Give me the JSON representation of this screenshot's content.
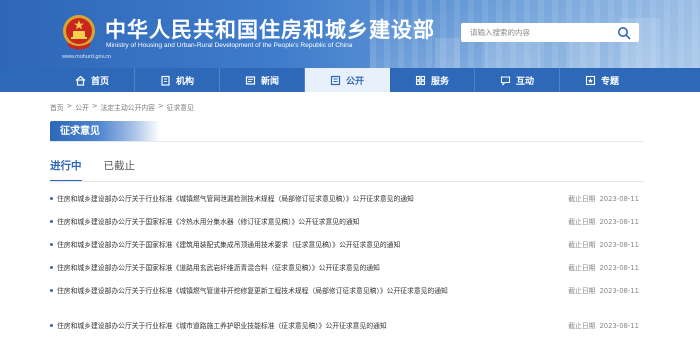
{
  "header": {
    "title": "中华人民共和国住房和城乡建设部",
    "subtitle": "Ministry of Housing and Urban-Rural Development of the People's Republic of China",
    "url": "www.mohurd.gov.cn",
    "search_placeholder": "请输入搜索的内容",
    "brand_color": "#2e68b8"
  },
  "nav": {
    "items": [
      {
        "label": "首页",
        "icon": "home-icon"
      },
      {
        "label": "机构",
        "icon": "building-icon"
      },
      {
        "label": "新闻",
        "icon": "news-icon"
      },
      {
        "label": "公开",
        "icon": "publicity-icon",
        "active": true
      },
      {
        "label": "服务",
        "icon": "service-icon"
      },
      {
        "label": "互动",
        "icon": "chat-icon"
      },
      {
        "label": "专题",
        "icon": "topic-icon"
      }
    ]
  },
  "breadcrumb": {
    "items": [
      "首页",
      "公开",
      "法定主动公开内容",
      "征求意见"
    ],
    "separator": ">"
  },
  "section": {
    "title": "征求意见"
  },
  "tabs": [
    {
      "label": "进行中",
      "active": true
    },
    {
      "label": "已截止",
      "active": false
    }
  ],
  "list": {
    "deadline_label": "截止日期",
    "items": [
      {
        "title": "住房和城乡建设部办公厅关于行业标准《城镇燃气管网泄漏检测技术规程（局部修订征求意见稿）》公开征求意见的通知",
        "date": "2023-08-11"
      },
      {
        "title": "住房和城乡建设部办公厅关于国家标准《冷热水用分集水器（修订征求意见稿）》公开征求意见的通知",
        "date": "2023-08-11"
      },
      {
        "title": "住房和城乡建设部办公厅关于国家标准《建筑用装配式集成吊顶通用技术要求（征求意见稿）》公开征求意见的通知",
        "date": "2023-08-11"
      },
      {
        "title": "住房和城乡建设部办公厅关于国家标准《道路用玄武岩纤维沥青混合料（征求意见稿）》公开征求意见的通知",
        "date": "2023-08-11"
      },
      {
        "title": "住房和城乡建设部办公厅关于行业标准《城镇燃气管道非开挖修复更新工程技术规程（局部修订征求意见稿）》公开征求意见的通知",
        "date": "2023-08-11"
      },
      {
        "title": "住房和城乡建设部办公厅关于行业标准《城市道路施工养护职业技能标准（征求意见稿）》公开征求意见的通知",
        "date": "2023-08-11"
      }
    ]
  }
}
